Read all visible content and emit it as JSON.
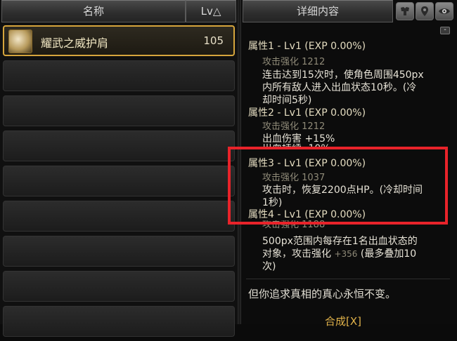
{
  "header": {
    "name_label": "名称",
    "lv_label": "Lv△",
    "detail_label": "详细内容",
    "icons": [
      "armor-icon",
      "pin-icon",
      "eye-icon"
    ]
  },
  "item": {
    "name": "耀武之威护肩",
    "level": "105"
  },
  "details": {
    "collapse_symbol": "-",
    "attr1": {
      "title": "属性1 - Lv1 (EXP 0.00%)",
      "sub": "攻击强化 1212",
      "desc": [
        "连击达到15次时，使角色周围450px",
        "内所有敌人进入出血状态10秒。(冷",
        "却时间5秒)"
      ]
    },
    "attr2": {
      "title": "属性2 - Lv1 (EXP 0.00%)",
      "sub": "攻击强化 1212",
      "desc": [
        "出血伤害 +15%"
      ],
      "partial": "出血持续 -10%"
    },
    "attr3": {
      "title": "属性3 - Lv1 (EXP 0.00%)",
      "sub": "攻击强化 1037",
      "desc": [
        "攻击时，恢复2200点HP。(冷却时间",
        "1秒)"
      ]
    },
    "attr4": {
      "title": "属性4 - Lv1 (EXP 0.00%)",
      "sub": "攻击强化 1188",
      "desc": [
        "500px范围内每存在1名出血状态的",
        "对象，攻击强化"
      ],
      "desc_plus": "+356",
      "desc_tail": "(最多叠加10",
      "desc_end": "次)"
    },
    "flavor": "但你追求真相的真心永恒不变。",
    "bottom": "合成[X]"
  },
  "colors": {
    "highlight": "#e8232a",
    "selected_border": "#d6a53c"
  }
}
